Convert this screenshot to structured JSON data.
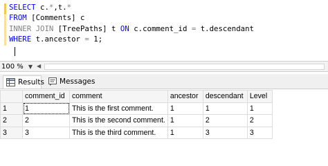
{
  "editor": {
    "lines": [
      [
        {
          "t": "SELECT",
          "c": "kw"
        },
        {
          "t": " c.",
          "c": ""
        },
        {
          "t": "*",
          "c": "op"
        },
        {
          "t": ",t.",
          "c": ""
        },
        {
          "t": "*",
          "c": "op"
        }
      ],
      [
        {
          "t": "FROM",
          "c": "kw"
        },
        {
          "t": " [Comments] c",
          "c": ""
        }
      ],
      [
        {
          "t": "INNER JOIN",
          "c": "op"
        },
        {
          "t": " [TreePaths] t ",
          "c": ""
        },
        {
          "t": "ON",
          "c": "kw"
        },
        {
          "t": " c.comment_id ",
          "c": ""
        },
        {
          "t": "=",
          "c": "op"
        },
        {
          "t": " t.descendant",
          "c": ""
        }
      ],
      [
        {
          "t": "WHERE",
          "c": "kw"
        },
        {
          "t": " t.ancestor ",
          "c": ""
        },
        {
          "t": "=",
          "c": "op"
        },
        {
          "t": " 1;",
          "c": ""
        }
      ]
    ]
  },
  "zoom": {
    "value": "100 %"
  },
  "tabs": {
    "results_label": "Results",
    "messages_label": "Messages"
  },
  "grid": {
    "columns": [
      "",
      "comment_id",
      "comment",
      "ancestor",
      "descendant",
      "Level"
    ],
    "rows": [
      [
        "1",
        "1",
        "This is the first comment.",
        "1",
        "1",
        "1"
      ],
      [
        "2",
        "2",
        "This is the second comment.",
        "1",
        "2",
        "2"
      ],
      [
        "3",
        "3",
        "This is the third comment.",
        "1",
        "3",
        "3"
      ]
    ]
  },
  "icons": {
    "results": "grid-icon",
    "messages": "message-icon"
  },
  "colors": {
    "keyword": "#0000ff",
    "operator": "#808080",
    "marker": "#f2c94c"
  }
}
